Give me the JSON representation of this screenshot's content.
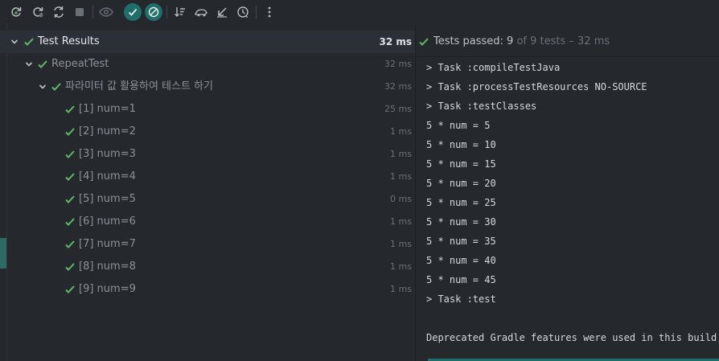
{
  "toolbar": {
    "buttons": [
      {
        "icon": "rerun-icon"
      },
      {
        "icon": "rerun-failed-icon"
      },
      {
        "icon": "toggle-auto-test-icon"
      },
      {
        "icon": "stop-icon"
      },
      {
        "icon": "show-passed-eye-icon"
      },
      {
        "icon": "show-passed-check-icon"
      },
      {
        "icon": "show-ignored-icon"
      },
      {
        "icon": "sort-alphabetically-icon"
      },
      {
        "icon": "sort-by-duration-icon"
      },
      {
        "icon": "collapse-all-icon"
      },
      {
        "icon": "history-icon"
      },
      {
        "icon": "more-options-icon"
      }
    ]
  },
  "tree": {
    "root": {
      "label": "Test Results",
      "duration": "32 ms"
    },
    "class": {
      "label": "RepeatTest",
      "duration": "32 ms"
    },
    "method": {
      "label": "파라미터 값 활용하여 테스트 하기",
      "duration": "32 ms"
    },
    "items": [
      {
        "label": "[1] num=1",
        "duration": "25 ms"
      },
      {
        "label": "[2] num=2",
        "duration": "1 ms"
      },
      {
        "label": "[3] num=3",
        "duration": "1 ms"
      },
      {
        "label": "[4] num=4",
        "duration": "1 ms"
      },
      {
        "label": "[5] num=5",
        "duration": "0 ms"
      },
      {
        "label": "[6] num=6",
        "duration": "1 ms"
      },
      {
        "label": "[7] num=7",
        "duration": "1 ms"
      },
      {
        "label": "[8] num=8",
        "duration": "1 ms"
      },
      {
        "label": "[9] num=9",
        "duration": "1 ms"
      }
    ]
  },
  "status": {
    "prefix": "Tests passed: ",
    "passed": "9",
    "suffix": " of 9 tests – 32 ms"
  },
  "console": {
    "lines": [
      "> Task :compileTestJava",
      "> Task :processTestResources NO-SOURCE",
      "> Task :testClasses",
      "5 * num = 5",
      "5 * num = 10",
      "5 * num = 15",
      "5 * num = 20",
      "5 * num = 25",
      "5 * num = 30",
      "5 * num = 35",
      "5 * num = 40",
      "5 * num = 45",
      "> Task :test",
      "",
      "Deprecated Gradle features were used in this build,"
    ]
  },
  "colors": {
    "pass": "#5fb865",
    "accent": "#1e6e6a",
    "background": "#25292e"
  }
}
